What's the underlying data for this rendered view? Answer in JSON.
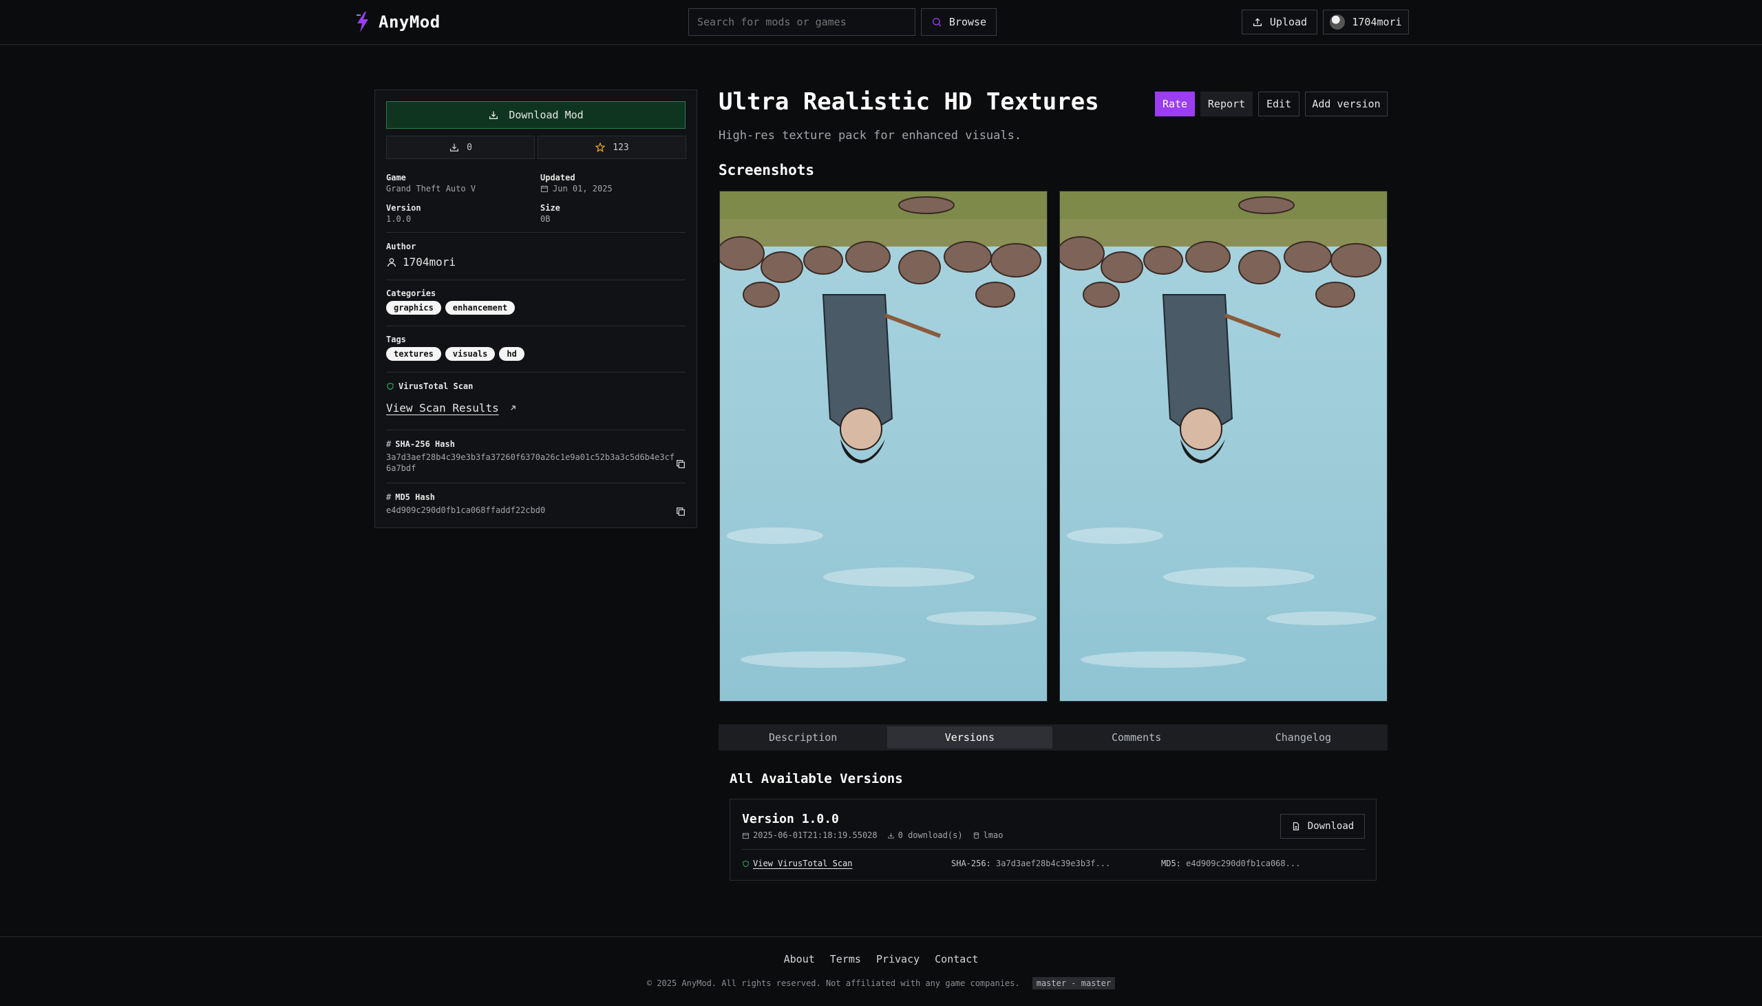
{
  "header": {
    "app_name": "AnyMod",
    "search_placeholder": "Search for mods or games",
    "browse_label": "Browse",
    "upload_label": "Upload",
    "username": "1704mori"
  },
  "sidebar": {
    "download_label": "Download Mod",
    "downloads_count": "0",
    "rating_count": "123",
    "game_label": "Game",
    "game_value": "Grand Theft Auto V",
    "updated_label": "Updated",
    "updated_value": "Jun 01, 2025",
    "version_label": "Version",
    "version_value": "1.0.0",
    "size_label": "Size",
    "size_value": "0B",
    "author_label": "Author",
    "author_value": "1704mori",
    "categories_label": "Categories",
    "categories": [
      "graphics",
      "enhancement"
    ],
    "tags_label": "Tags",
    "tags": [
      "textures",
      "visuals",
      "hd"
    ],
    "virustotal_label": "VirusTotal Scan",
    "scan_link": "View Scan Results",
    "sha_label": "SHA-256 Hash",
    "sha_value": "3a7d3aef28b4c39e3b3fa37260f6370a26c1e9a01c52b3a3c5d6b4e3cf6a7bdf",
    "md5_label": "MD5 Hash",
    "md5_value": "e4d909c290d0fb1ca068ffaddf22cbd0"
  },
  "main": {
    "title": "Ultra Realistic HD Textures",
    "subtitle": "High-res texture pack for enhanced visuals.",
    "actions": {
      "rate": "Rate",
      "report": "Report",
      "edit": "Edit",
      "add_version": "Add version"
    },
    "screenshots_heading": "Screenshots",
    "tabs": [
      "Description",
      "Versions",
      "Comments",
      "Changelog"
    ],
    "active_tab": "Versions",
    "versions_heading": "All Available Versions",
    "version_card": {
      "name": "Version 1.0.0",
      "date": "2025-06-01T21:18:19.55028",
      "downloads": "0 download(s)",
      "uploader": "lmao",
      "download_label": "Download",
      "scan_link": "View VirusTotal Scan",
      "sha_label": "SHA-256:",
      "sha_short": "3a7d3aef28b4c39e3b3f...",
      "md5_label": "MD5:",
      "md5_short": "e4d909c290d0fb1ca068..."
    }
  },
  "footer": {
    "links": [
      "About",
      "Terms",
      "Privacy",
      "Contact"
    ],
    "copyright": "© 2025 AnyMod. All rights reserved. Not affiliated with any game companies.",
    "branch_badge": "master - master"
  },
  "colors": {
    "accent_purple": "#9b3df0",
    "download_green_bg": "#0f3520",
    "download_green_border": "#2e7d4b",
    "star": "#e3a21a",
    "shield": "#2fbf6a"
  }
}
